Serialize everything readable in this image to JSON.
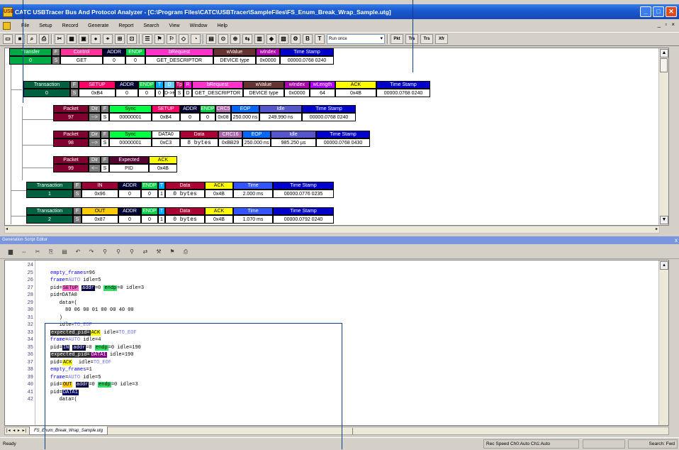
{
  "window": {
    "title": "CATC USBTracer Bus And Protocol Analyzer - [C:\\Program Files\\CATC\\USBTracer\\SampleFiles\\FS_Enum_Break_Wrap_Sample.utg]",
    "app_icon_label": "USB",
    "minimize": "_",
    "maximize": "□",
    "close": "✕",
    "mdi_controls": "_ ▫ ×"
  },
  "menu": [
    "File",
    "Setup",
    "Record",
    "Generate",
    "Report",
    "Search",
    "View",
    "Window",
    "Help"
  ],
  "toolbar": {
    "icons": [
      "new-file-icon",
      "save-icon",
      "print-preview-icon",
      "print-icon",
      "cut-icon",
      "capture-icon",
      "record-icon",
      "rec-dot-icon",
      "find-icon",
      "filter-icon",
      "bookmark-icon",
      "sof-icon",
      "decode-icon",
      "hide-icon",
      "arrow-icon",
      "compare-icon",
      "spec-icon",
      "device-icon",
      "power-icon",
      "bus-icon",
      "chart-icon",
      "bluetooth-icon",
      "stats-icon",
      "generator-icon",
      "bold-b-icon",
      "bold-t-icon"
    ],
    "glyphs": [
      "▭",
      "■",
      "⌕",
      "⎙",
      "✂",
      "▦",
      "▣",
      "●",
      "⌖",
      "⊞",
      "⊡",
      "☰",
      "⚑",
      "⚐",
      "◇",
      "◔",
      "▤",
      "⊙",
      "⊕",
      "⇆",
      "▥",
      "◈",
      "▧",
      "⚙",
      "B",
      "T"
    ],
    "run_mode": "Run once",
    "level_buttons": [
      "Pkt",
      "Trs",
      "Trs",
      "Xfr"
    ]
  },
  "trace": {
    "transfer": {
      "headers": [
        "Transfer",
        "F",
        "Control",
        "ADDR",
        "ENDP",
        "bRequest",
        "wValue",
        "wIndex",
        "Time Stamp"
      ],
      "values": [
        "0",
        "S",
        "GET",
        "0",
        "0",
        "GET_DESCRIPTOR",
        "DEVICE type",
        "0x0000",
        "00000.0768 0240"
      ]
    },
    "transaction0": {
      "headers": [
        "Transaction",
        "F",
        "SETUP",
        "ADDR",
        "ENDP",
        "T",
        "D",
        "Tp",
        "R",
        "bRequest",
        "wValue",
        "wIndex",
        "wLength",
        "ACK",
        "Time Stamp"
      ],
      "values": [
        "0",
        "S",
        "0xB4",
        "0",
        "0",
        "0",
        "D->H",
        "S",
        "D",
        "GET_DESCRIPTOR",
        "DEVICE type",
        "0x0000",
        "64",
        "0x4B",
        "00000.0768 0240"
      ]
    },
    "packet97": {
      "headers": [
        "Packet",
        "Dir",
        "F",
        "Sync",
        "SETUP",
        "ADDR",
        "ENDP",
        "CRC5",
        "EOP",
        "Idle",
        "Time Stamp"
      ],
      "values": [
        "97",
        "-->",
        "S",
        "00000001",
        "0xB4",
        "0",
        "0",
        "0x08",
        "250.000 ns",
        "249.990 ns",
        "00000.0768 0240"
      ]
    },
    "packet98": {
      "headers": [
        "Packet",
        "Dir",
        "F",
        "Sync",
        "DATA0",
        "Data",
        "CRC16",
        "EOP",
        "Idle",
        "Time Stamp"
      ],
      "values": [
        "98",
        "-->",
        "S",
        "00000001",
        "0xC3",
        "8 bytes",
        "0xBB29",
        "250.000 ns",
        "985.250 µs",
        "00000.0768 0430"
      ]
    },
    "packet99": {
      "headers": [
        "Packet",
        "Dir",
        "F",
        "Expected",
        "ACK"
      ],
      "values": [
        "99",
        "<--",
        "S",
        "PID",
        "0x4B"
      ]
    },
    "transaction1": {
      "headers": [
        "Transaction",
        "F",
        "IN",
        "ADDR",
        "ENDP",
        "T",
        "Data",
        "ACK",
        "Time",
        "Time Stamp"
      ],
      "values": [
        "1",
        "S",
        "0x96",
        "0",
        "0",
        "1",
        "0 bytes",
        "0x4B",
        "2.000 ms",
        "00000.0776 0235"
      ]
    },
    "transaction2": {
      "headers": [
        "Transaction",
        "F",
        "OUT",
        "ADDR",
        "ENDP",
        "T",
        "Data",
        "ACK",
        "Time",
        "Time Stamp"
      ],
      "values": [
        "2",
        "S",
        "0x87",
        "0",
        "0",
        "1",
        "0 bytes",
        "0x4B",
        "1.070 ms",
        "00000.0792 0240"
      ]
    }
  },
  "editor": {
    "pane_title": "Generation Script Editor",
    "pane_close": "x",
    "icons": [
      "open-icon",
      "bookmark-toggle-icon",
      "cut-icon",
      "copy-icon",
      "paste-icon",
      "undo-icon",
      "redo-icon",
      "find-icon",
      "find-next-icon",
      "find-prev-icon",
      "replace-icon",
      "compile-icon",
      "run-icon",
      "print-icon"
    ],
    "glyphs": [
      "▆",
      "⇔",
      "✂",
      "⎘",
      "▤",
      "↶",
      "↷",
      "⚲",
      "⚲",
      "⚲",
      "⇄",
      "⚒",
      "⚑",
      "⎙"
    ],
    "lines": [
      {
        "n": "24",
        "segs": []
      },
      {
        "n": "25",
        "segs": [
          {
            "t": "empty_frames",
            "c": "k"
          },
          {
            "t": "=96"
          }
        ]
      },
      {
        "n": "26",
        "segs": [
          {
            "t": "frame",
            "c": "k"
          },
          {
            "t": "="
          },
          {
            "t": "AUTO",
            "c": "g"
          },
          {
            "t": " idle=5"
          }
        ]
      },
      {
        "n": "27",
        "segs": [
          {
            "t": "pid="
          },
          {
            "t": "SETUP",
            "bg": "#ff66cc"
          },
          {
            "t": " "
          },
          {
            "t": "addr",
            "bg": "#000040",
            "fg": "#fff"
          },
          {
            "t": "=0 "
          },
          {
            "t": "endp",
            "bg": "#33dd66"
          },
          {
            "t": "=0 idle=3"
          }
        ]
      },
      {
        "n": "28",
        "segs": [
          {
            "t": "pid=DATA0"
          }
        ]
      },
      {
        "n": "29",
        "segs": [
          {
            "t": "   data=("
          }
        ]
      },
      {
        "n": "30",
        "segs": [
          {
            "t": "     80 06 00 01 00 00 40 00"
          }
        ]
      },
      {
        "n": "31",
        "segs": [
          {
            "t": "   )"
          }
        ]
      },
      {
        "n": "32",
        "segs": [
          {
            "t": "   idle="
          },
          {
            "t": "TO_EOF",
            "c": "g"
          }
        ]
      },
      {
        "n": "33",
        "segs": [
          {
            "t": "expected_pid=",
            "bg": "#303030",
            "fg": "#fff"
          },
          {
            "t": "ACK",
            "bg": "#ffff00"
          },
          {
            "t": " idle="
          },
          {
            "t": "TO_EOF",
            "c": "g"
          }
        ]
      },
      {
        "n": "34",
        "segs": [
          {
            "t": "frame",
            "c": "k"
          },
          {
            "t": "="
          },
          {
            "t": "AUTO",
            "c": "g"
          },
          {
            "t": " idle=4"
          }
        ]
      },
      {
        "n": "35",
        "segs": [
          {
            "t": "pid="
          },
          {
            "t": "IN",
            "bg": "#000040",
            "fg": "#fff"
          },
          {
            "t": " "
          },
          {
            "t": "addr",
            "bg": "#000040",
            "fg": "#fff"
          },
          {
            "t": "=0 "
          },
          {
            "t": "endp",
            "bg": "#33dd66"
          },
          {
            "t": "=0 idle=190"
          }
        ]
      },
      {
        "n": "36",
        "segs": [
          {
            "t": "expected_pid=",
            "bg": "#303030",
            "fg": "#fff"
          },
          {
            "t": "DATA1",
            "bg": "#800080",
            "fg": "#fff"
          },
          {
            "t": " idle=190"
          }
        ]
      },
      {
        "n": "37",
        "segs": [
          {
            "t": "pid="
          },
          {
            "t": "ACK",
            "bg": "#ffff00"
          },
          {
            "t": "  idle="
          },
          {
            "t": "TO_EOF",
            "c": "g"
          }
        ]
      },
      {
        "n": "38",
        "segs": [
          {
            "t": "empty_frames",
            "c": "k"
          },
          {
            "t": "=1"
          }
        ]
      },
      {
        "n": "39",
        "segs": [
          {
            "t": "frame",
            "c": "k"
          },
          {
            "t": "="
          },
          {
            "t": "AUTO",
            "c": "g"
          },
          {
            "t": " idle=5"
          }
        ]
      },
      {
        "n": "40",
        "segs": [
          {
            "t": "pid="
          },
          {
            "t": "OUT",
            "bg": "#ffcc00"
          },
          {
            "t": " "
          },
          {
            "t": "addr",
            "bg": "#000040",
            "fg": "#fff"
          },
          {
            "t": "=0 "
          },
          {
            "t": "endp",
            "bg": "#33dd66"
          },
          {
            "t": "=0 idle=3"
          }
        ]
      },
      {
        "n": "41",
        "segs": [
          {
            "t": "pid="
          },
          {
            "t": "DATA1",
            "bg": "#000060",
            "fg": "#fff"
          }
        ]
      },
      {
        "n": "42",
        "segs": [
          {
            "t": "   data=("
          }
        ]
      }
    ]
  },
  "tabs": {
    "nav": "|◂ ◂ ▸ ▸|",
    "active": "FS_Enum_Break_Wrap_Sample.utg"
  },
  "status": {
    "left": "Ready",
    "rec_speed": "Rec Speed  Ch0:Auto  Ch1:Auto",
    "search": "Search: Fwd"
  },
  "colors": {
    "transfer": "#00aa44",
    "transaction": "#006040",
    "packet": "#800030",
    "dirgray": "#808080",
    "control": "#ff3399",
    "addr": "#000033",
    "endp": "#00cc44",
    "brequest": "#ff33cc",
    "wvalue": "#663333",
    "windex": "#aa00aa",
    "timestamp": "#0000cc",
    "setup": "#ff0066",
    "t": "#00aaff",
    "d": "#66ccff",
    "tp": "#cc0066",
    "r": "#ff00cc",
    "wlength": "#aa00ff",
    "ack": "#ffff00",
    "sync": "#00ff44",
    "crc": "#aa66aa",
    "eop": "#0066ff",
    "idle": "#5555cc",
    "data0": "#ffffff",
    "data": "#aa0033",
    "expected": "#550033",
    "in": "#990033",
    "time": "#3355ff",
    "out": "#ffcc00"
  }
}
